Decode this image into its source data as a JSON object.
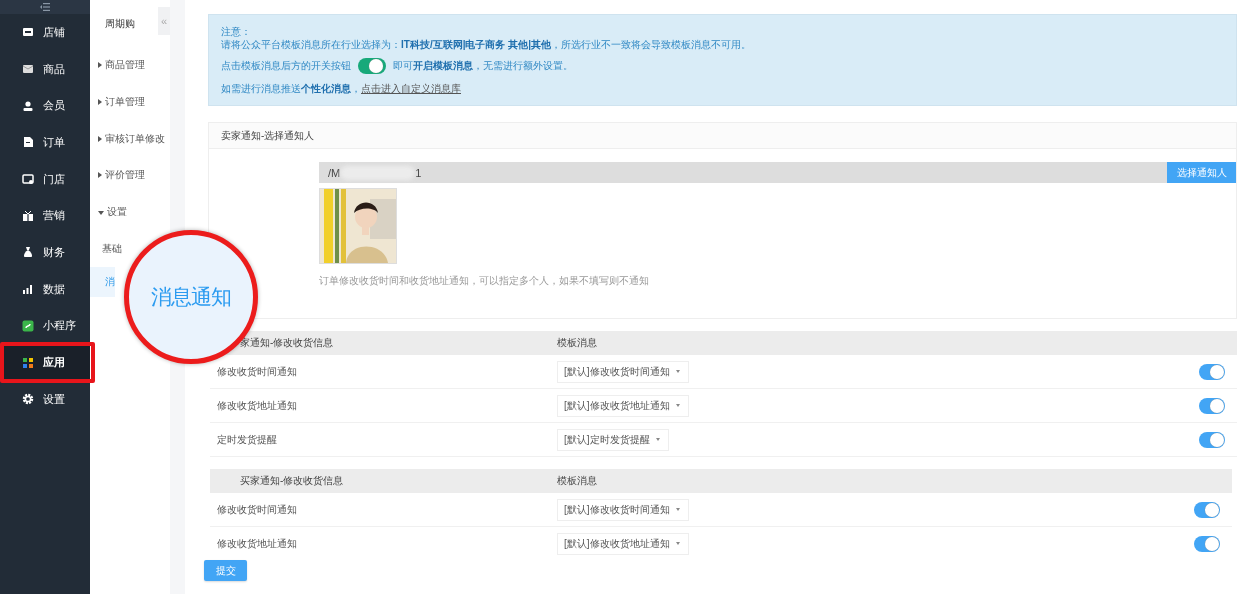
{
  "sidebar": {
    "items": [
      {
        "label": "店铺",
        "selected": false,
        "highlighted": false
      },
      {
        "label": "商品",
        "selected": false,
        "highlighted": false
      },
      {
        "label": "会员",
        "selected": false,
        "highlighted": false
      },
      {
        "label": "订单",
        "selected": false,
        "highlighted": false
      },
      {
        "label": "门店",
        "selected": false,
        "highlighted": false
      },
      {
        "label": "营销",
        "selected": false,
        "highlighted": false
      },
      {
        "label": "财务",
        "selected": false,
        "highlighted": false
      },
      {
        "label": "数据",
        "selected": false,
        "highlighted": false
      },
      {
        "label": "小程序",
        "selected": false,
        "highlighted": false
      },
      {
        "label": "应用",
        "selected": true,
        "highlighted": true
      },
      {
        "label": "设置",
        "selected": false,
        "highlighted": false
      }
    ]
  },
  "subnav": {
    "title": "周期购",
    "collapse_button": "«",
    "items": [
      {
        "label": "商品管理",
        "expanded": false,
        "selected": false
      },
      {
        "label": "订单管理",
        "expanded": false,
        "selected": false
      },
      {
        "label": "审核订单修改",
        "expanded": false,
        "selected": false
      },
      {
        "label": "评价管理",
        "expanded": false,
        "selected": false
      },
      {
        "label": "设置",
        "expanded": true,
        "selected": false,
        "children": [
          {
            "label": "基础",
            "selected": false
          },
          {
            "label": "消",
            "selected": true
          }
        ]
      }
    ]
  },
  "magnifier": {
    "text": "消息通知"
  },
  "notice": {
    "title": "注意：",
    "industry_text": "请将公众平台模板消息所在行业选择为：**IT科技/互联网|电子商务 其他|其他**，所选行业不一致将会导致模板消息不可用。",
    "switch_hint": {
      "before": "点击模板消息后方的开关按钮",
      "on": true,
      "after": "即可**开启模板消息**，无需进行额外设置。"
    },
    "custom_hint": {
      "text": "如需进行消息推送**个性化消息**，",
      "link": "点击进入自定义消息库"
    }
  },
  "seller_card": {
    "title": "卖家通知-选择通知人",
    "recipient_field": {
      "value_start": "/M",
      "value_end": "1"
    },
    "button": "选择通知人",
    "caption": "订单修改收货时间和收货地址通知，可以指定多个人，如果不填写则不通知"
  },
  "tables": [
    {
      "title": "家通知-修改收货信息",
      "column_2": "模板消息",
      "rows": [
        {
          "name": "修改收货时间通知",
          "template": "[默认]修改收货时间通知",
          "enabled": true
        },
        {
          "name": "修改收货地址通知",
          "template": "[默认]修改收货地址通知",
          "enabled": true
        },
        {
          "name": "定时发货提醒",
          "template": "[默认]定时发货提醒",
          "enabled": true
        }
      ]
    },
    {
      "title": "买家通知-修改收货信息",
      "column_2": "模板消息",
      "rows": [
        {
          "name": "修改收货时间通知",
          "template": "[默认]修改收货时间通知",
          "enabled": true
        },
        {
          "name": "修改收货地址通知",
          "template": "[默认]修改收货地址通知",
          "enabled": true
        }
      ]
    }
  ],
  "submit_button": "提交"
}
